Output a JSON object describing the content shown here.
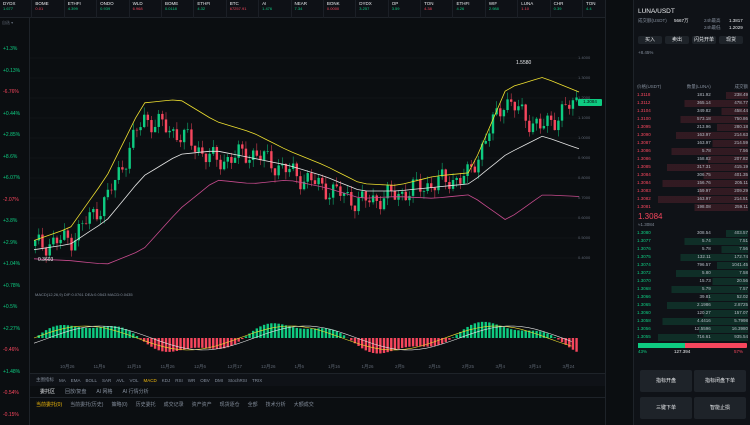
{
  "ticker": [
    {
      "sym": "DYDX",
      "sub": "1.677"
    },
    {
      "sym": "BOME",
      "sub": "0.01"
    },
    {
      "sym": "ETHFI",
      "sub": "4.399"
    },
    {
      "sym": "ONDO",
      "sub": "0.939"
    },
    {
      "sym": "WLD",
      "sub": "6.968"
    },
    {
      "sym": "BOME",
      "sub": "0.0118"
    },
    {
      "sym": "ETHFI",
      "sub": "4.32"
    },
    {
      "sym": "BTC",
      "sub": "67257.91"
    },
    {
      "sym": "AI",
      "sub": "1.476"
    },
    {
      "sym": "NEAR",
      "sub": "7.34"
    },
    {
      "sym": "BONK",
      "sub": "0.0000"
    },
    {
      "sym": "DYDX",
      "sub": "3.257"
    },
    {
      "sym": "OP",
      "sub": "3.59"
    },
    {
      "sym": "TON",
      "sub": "4.38"
    },
    {
      "sym": "ETHFI",
      "sub": "4.26"
    },
    {
      "sym": "WIF",
      "sub": "2.988"
    },
    {
      "sym": "LUNA",
      "sub": "1.10"
    },
    {
      "sym": "CHR",
      "sub": "0.39"
    },
    {
      "sym": "TON",
      "sub": "4.4"
    },
    {
      "sym": "DEXE",
      "sub": "9.36"
    },
    {
      "sym": "LUNA/USDT",
      "sub": "1.3110"
    }
  ],
  "toolbar": {
    "interval": "1D",
    "items": [
      "指标",
      "全屏",
      "设置",
      "截图",
      "更多"
    ]
  },
  "info_line": "2024-03-25 08:00  开:1.2120 高:1.3817 低:1.2029 收:1.3084 涨幅:8.45%",
  "boll_line": "BOLL(20,2)  BOLL:1.0472  UB:1.3019  LB:0.7925",
  "macd_line": "MACD(12,26,9)  DIF:0.0761  DEA:0.0543  MACD:0.0435",
  "left_pcts": [
    {
      "v": "+1.3%",
      "c": "up"
    },
    {
      "v": "+0.13%",
      "c": "up"
    },
    {
      "v": "-6.76%",
      "c": "dn"
    },
    {
      "v": "+0.44%",
      "c": "up"
    },
    {
      "v": "+2.85%",
      "c": "up"
    },
    {
      "v": "+8.6%",
      "c": "up"
    },
    {
      "v": "+6.07%",
      "c": "up"
    },
    {
      "v": "-2.07%",
      "c": "dn"
    },
    {
      "v": "+3.8%",
      "c": "up"
    },
    {
      "v": "+2.9%",
      "c": "up"
    },
    {
      "v": "+1.04%",
      "c": "up"
    },
    {
      "v": "+0.78%",
      "c": "up"
    },
    {
      "v": "+0.5%",
      "c": "up"
    },
    {
      "v": "+2.27%",
      "c": "up"
    },
    {
      "v": "-0.46%",
      "c": "dn"
    },
    {
      "v": "+1.48%",
      "c": "up"
    },
    {
      "v": "-0.54%",
      "c": "dn"
    },
    {
      "v": "-0.15%",
      "c": "dn"
    }
  ],
  "price_axis": [
    "1.4000",
    "1.3000",
    "1.2000",
    "1.1000",
    "1.0000",
    "0.9000",
    "0.8000",
    "0.7000",
    "0.6000",
    "0.5000",
    "0.4000"
  ],
  "x_dates": [
    "10月26",
    "11月6",
    "11月15",
    "11月26",
    "12月6",
    "12月17",
    "12月26",
    "1月6",
    "1月16",
    "1月26",
    "2月5",
    "2月15",
    "2月25",
    "3月4",
    "3月14",
    "3月24"
  ],
  "high_label": "1.5580",
  "low_label": "0.3603",
  "current_price_tag": "1.3084",
  "indicators": {
    "active": "MACD",
    "items": [
      "主图指标",
      "MA",
      "EMA",
      "BOLL",
      "SAR",
      "AVL",
      "VOL",
      "MACD",
      "KDJ",
      "RSI",
      "WR",
      "OBV",
      "DMI",
      "StochRSI",
      "TRIX"
    ]
  },
  "tabs2": [
    {
      "label": "委托区",
      "on": true
    },
    {
      "label": "回放/复盘",
      "on": false
    },
    {
      "label": "AI 网格",
      "on": false
    },
    {
      "label": "AI 行情分析",
      "on": false
    }
  ],
  "tabs3": [
    {
      "label": "当前委托(0)",
      "on": true
    },
    {
      "label": "当前委托(历史)",
      "on": false
    },
    {
      "label": "策略(0)",
      "on": false
    },
    {
      "label": "历史委托",
      "on": false
    },
    {
      "label": "成交记录",
      "on": false
    },
    {
      "label": "资产资产",
      "on": false
    },
    {
      "label": "现货逐仓",
      "on": false
    },
    {
      "label": "全部",
      "on": false
    },
    {
      "label": "技术分析",
      "on": false
    },
    {
      "label": "大额成交",
      "on": false
    }
  ],
  "book": {
    "pair": "LUNA/USDT",
    "last": "1.3084",
    "change": "+8.45%",
    "vol_label": "成交额(USDT)",
    "vol": "5667万",
    "high_label": "24h最高",
    "high": "1.3817",
    "low_label": "24h最低",
    "low": "1.2029",
    "headers": [
      "价格(USDT)",
      "数量(LUNA)",
      "成交额"
    ],
    "asks": [
      [
        "1.3118",
        "181.92",
        "238.49"
      ],
      [
        "1.3112",
        "365.14",
        "478.77"
      ],
      [
        "1.3104",
        "349.82",
        "458.44"
      ],
      [
        "1.3100",
        "573.18",
        "750.86"
      ],
      [
        "1.3095",
        "213.96",
        "280.18"
      ],
      [
        "1.3090",
        "163.97",
        "214.63"
      ],
      [
        "1.3087",
        "163.97",
        "214.59"
      ],
      [
        "1.3086",
        "5.78",
        "7.56"
      ],
      [
        "1.3086",
        "158.82",
        "207.82"
      ],
      [
        "1.3085",
        "317.31",
        "415.19"
      ],
      [
        "1.3084",
        "306.75",
        "401.35"
      ],
      [
        "1.3084",
        "156.76",
        "205.11"
      ],
      [
        "1.3083",
        "159.97",
        "209.29"
      ],
      [
        "1.3082",
        "163.97",
        "214.51"
      ],
      [
        "1.3081",
        "198.08",
        "259.11"
      ]
    ],
    "mid": "1.3084",
    "mid_sub": "≈1.3084",
    "bids": [
      [
        "1.3080",
        "308.54",
        "403.57"
      ],
      [
        "1.3077",
        "5.74",
        "7.51"
      ],
      [
        "1.3076",
        "5.78",
        "7.56"
      ],
      [
        "1.3075",
        "132.11",
        "172.74"
      ],
      [
        "1.3074",
        "796.57",
        "1041.45"
      ],
      [
        "1.3072",
        "5.80",
        "7.58"
      ],
      [
        "1.3070",
        "15.73",
        "20.56"
      ],
      [
        "1.3068",
        "5.79",
        "7.57"
      ],
      [
        "1.3066",
        "39.81",
        "52.02"
      ],
      [
        "1.3065",
        "2.1986",
        "2.8725"
      ],
      [
        "1.3060",
        "120.27",
        "157.07"
      ],
      [
        "1.3058",
        "4.4416",
        "5.7998"
      ],
      [
        "1.3056",
        "12.5596",
        "16.3980"
      ],
      [
        "1.3055",
        "716.61",
        "935.54"
      ]
    ],
    "ratio_buy": "43%",
    "ratio_sell": "57%",
    "depth": "127.394",
    "buttons": [
      "买入",
      "卖出",
      "闪兑开单",
      "现货"
    ],
    "actions": [
      "指标开盘",
      "指标闭盘下单",
      "三键下单",
      "智能止损"
    ]
  },
  "colors": {
    "up": "#0ecb81",
    "down": "#f6465d",
    "accent": "#f0b90b",
    "boll_mid": "#e6e6e6",
    "boll_up": "#f0e130",
    "boll_lb": "#c84b8e"
  },
  "chart_data": {
    "type": "candlestick",
    "title": "LUNA/USDT 1D",
    "ylim": [
      0.4,
      1.6
    ],
    "x": [
      "10月26",
      "11月6",
      "11月15",
      "11月26",
      "12月6",
      "12月17",
      "12月26",
      "1月6",
      "1月16",
      "1月26",
      "2月5",
      "2月15",
      "2月25",
      "3月4",
      "3月14",
      "3月24"
    ],
    "close": [
      0.52,
      0.56,
      0.78,
      1.22,
      1.13,
      0.98,
      1.03,
      0.93,
      0.84,
      0.76,
      0.8,
      0.86,
      0.9,
      1.32,
      1.16,
      1.31
    ],
    "boll_upper": [
      0.55,
      0.62,
      0.9,
      1.3,
      1.32,
      1.2,
      1.14,
      1.04,
      0.96,
      0.86,
      0.85,
      0.9,
      0.92,
      1.38,
      1.44,
      1.36
    ],
    "boll_mid": [
      0.5,
      0.53,
      0.66,
      0.9,
      1.02,
      1.04,
      1.0,
      0.96,
      0.9,
      0.82,
      0.82,
      0.84,
      0.86,
      1.02,
      1.12,
      1.05
    ],
    "boll_lower": [
      0.45,
      0.44,
      0.42,
      0.5,
      0.72,
      0.88,
      0.86,
      0.88,
      0.84,
      0.78,
      0.79,
      0.78,
      0.8,
      0.66,
      0.8,
      0.79
    ]
  }
}
